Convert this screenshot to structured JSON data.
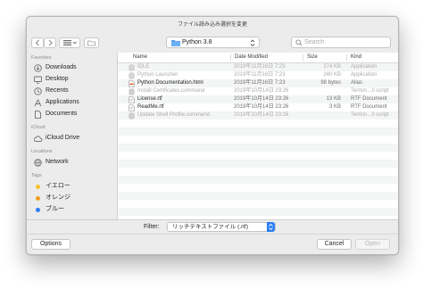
{
  "window": {
    "title": "ファイル読み込み選択を変更"
  },
  "toolbar": {
    "location": "Python 3.8",
    "search_placeholder": "Search"
  },
  "sidebar": {
    "favorites_header": "Favorites",
    "favorites": [
      {
        "label": "Downloads",
        "icon": "downloads-icon"
      },
      {
        "label": "Desktop",
        "icon": "desktop-icon"
      },
      {
        "label": "Recents",
        "icon": "clock-icon"
      },
      {
        "label": "Applications",
        "icon": "applications-icon"
      },
      {
        "label": "Documents",
        "icon": "document-icon"
      }
    ],
    "icloud_header": "iCloud",
    "icloud": [
      {
        "label": "iCloud Drive",
        "icon": "cloud-icon"
      }
    ],
    "locations_header": "Locations",
    "locations": [
      {
        "label": "Network",
        "icon": "globe-icon"
      }
    ],
    "tags_header": "Tags",
    "tags": [
      {
        "label": "イエロー",
        "color": "#f7c22c"
      },
      {
        "label": "オレンジ",
        "color": "#f39b1f"
      },
      {
        "label": "ブルー",
        "color": "#2f7cf6"
      }
    ]
  },
  "columns": {
    "name": "Name",
    "date": "Date Modified",
    "size": "Size",
    "kind": "Kind"
  },
  "files": [
    {
      "name": "IDLE",
      "date": "2019年11月16日 7:23",
      "size": "174 KB",
      "kind": "Application",
      "enabled": false,
      "icon": "app-icon"
    },
    {
      "name": "Python Launcher",
      "date": "2019年11月16日 7:23",
      "size": "240 KB",
      "kind": "Application",
      "enabled": false,
      "icon": "app-icon"
    },
    {
      "name": "Python Documentation.html",
      "date": "2019年11月16日 7:23",
      "size": "98 bytes",
      "kind": "Alias",
      "enabled": true,
      "icon": "html-file-icon"
    },
    {
      "name": "Install Certificates.command",
      "date": "2019年10月14日 23:26",
      "size": "",
      "kind": "Termin…ll script",
      "enabled": false,
      "icon": "script-file-icon"
    },
    {
      "name": "License.rtf",
      "date": "2019年10月14日 23:26",
      "size": "13 KB",
      "kind": "RTF Document",
      "enabled": true,
      "icon": "rtf-file-icon"
    },
    {
      "name": "ReadMe.rtf",
      "date": "2019年10月14日 23:26",
      "size": "3 KB",
      "kind": "RTF Document",
      "enabled": true,
      "icon": "rtf-file-icon"
    },
    {
      "name": "Update Shell Profile.command",
      "date": "2019年10月14日 23:26",
      "size": "",
      "kind": "Termin…ll script",
      "enabled": false,
      "icon": "script-file-icon"
    }
  ],
  "filter": {
    "label": "Filter:",
    "value": "リッチテキストファイル (.rtf)"
  },
  "buttons": {
    "options": "Options",
    "cancel": "Cancel",
    "open": "Open"
  }
}
